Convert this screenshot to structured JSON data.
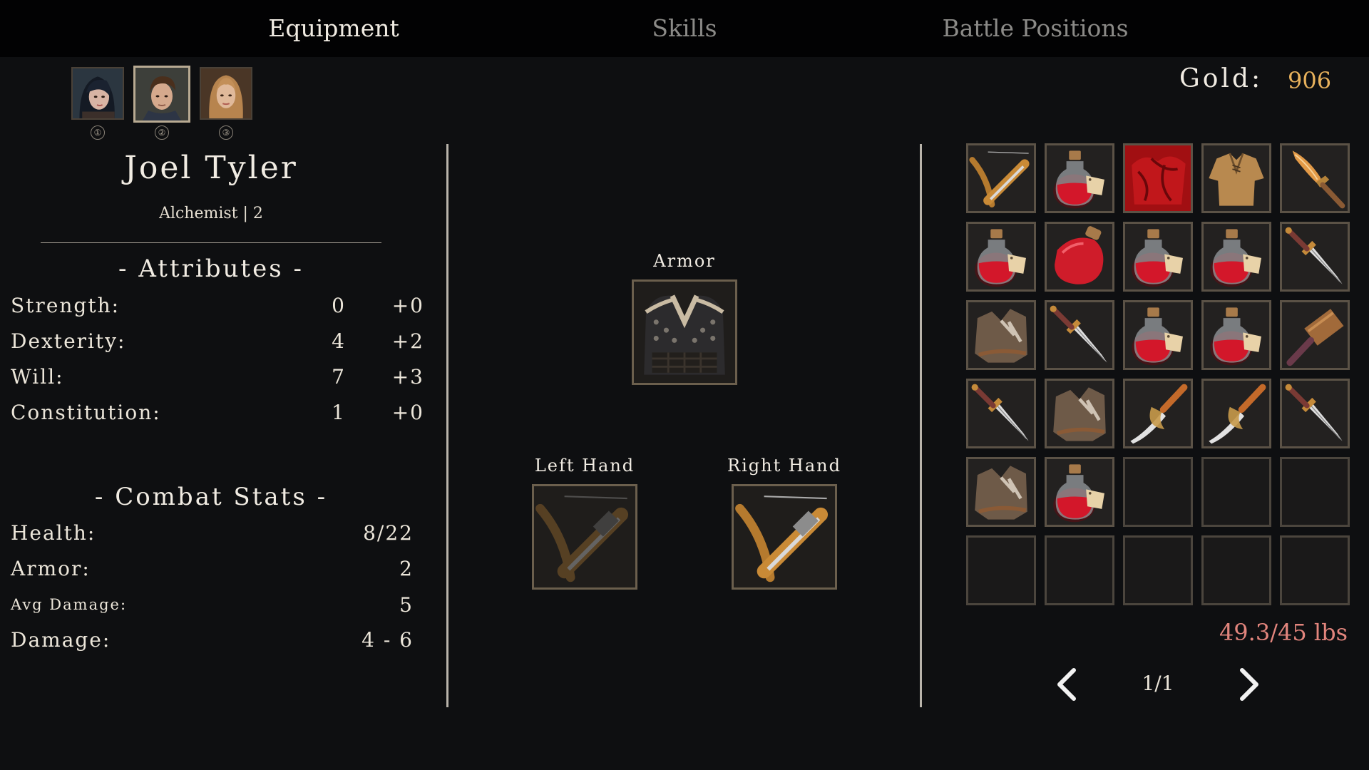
{
  "tabs": [
    {
      "label": "Equipment",
      "active": true
    },
    {
      "label": "Skills",
      "active": false
    },
    {
      "label": "Battle Positions",
      "active": false
    }
  ],
  "party": [
    {
      "number": "①",
      "portrait": "dark-haired-woman-portrait",
      "selected": false
    },
    {
      "number": "②",
      "portrait": "brown-haired-man-portrait",
      "selected": true
    },
    {
      "number": "③",
      "portrait": "blonde-woman-portrait",
      "selected": false
    }
  ],
  "character": {
    "name": "Joel Tyler",
    "class_level": "Alchemist | 2"
  },
  "attributes": {
    "title": "- Attributes -",
    "rows": [
      {
        "label": "Strength:",
        "base": "0",
        "bonus": "+0"
      },
      {
        "label": "Dexterity:",
        "base": "4",
        "bonus": "+2"
      },
      {
        "label": "Will:",
        "base": "7",
        "bonus": "+3"
      },
      {
        "label": "Constitution:",
        "base": "1",
        "bonus": "+0"
      }
    ]
  },
  "combat": {
    "title": "- Combat Stats -",
    "rows": [
      {
        "label": "Health:",
        "value": "8/22"
      },
      {
        "label": "Armor:",
        "value": "2"
      },
      {
        "label": "Avg Damage:",
        "value": "5"
      },
      {
        "label": "Damage:",
        "value": "4 - 6"
      }
    ]
  },
  "equipment": {
    "armor": {
      "label": "Armor",
      "item": "leather-armor-icon"
    },
    "left_hand": {
      "label": "Left Hand",
      "item": "crossbow-icon-faded"
    },
    "right_hand": {
      "label": "Right Hand",
      "item": "crossbow-icon"
    }
  },
  "gold": {
    "label": "Gold:",
    "value": "906"
  },
  "inventory": {
    "items": [
      "crossbow",
      "health-potion",
      "red-cloth",
      "leather-shirt",
      "flame-dagger",
      "health-potion",
      "red-flask",
      "health-potion",
      "health-potion",
      "dagger",
      "torn-leather-vest",
      "dagger",
      "health-potion",
      "health-potion",
      "wooden-hammer",
      "dagger",
      "torn-leather-vest",
      "curved-sword",
      "curved-sword",
      "dagger",
      "torn-leather-vest",
      "health-potion",
      "empty",
      "empty",
      "empty",
      "empty",
      "empty",
      "empty",
      "empty",
      "empty"
    ],
    "weight": "49.3/45 lbs",
    "page": "1/1"
  },
  "colors": {
    "gold": "#e7b15c",
    "overweight": "#e2857d",
    "slot_border": "#6b5f4d"
  }
}
